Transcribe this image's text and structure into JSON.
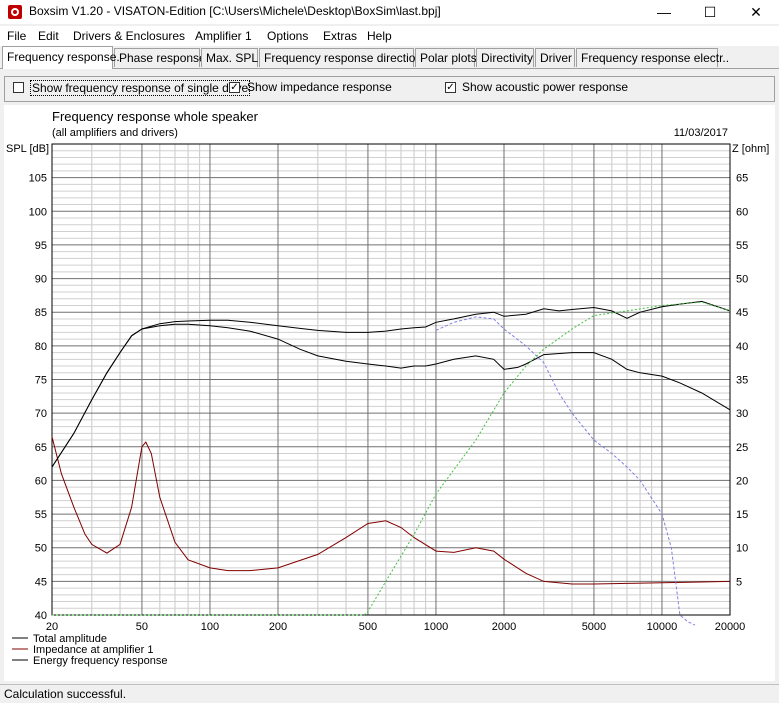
{
  "window": {
    "title": "Boxsim V1.20 - VISATON-Edition [C:\\Users\\Michele\\Desktop\\BoxSim\\last.bpj]",
    "minimize_glyph": "—",
    "maximize_glyph": "☐",
    "close_glyph": "✕"
  },
  "menu": [
    "File",
    "Edit",
    "Drivers & Enclosures",
    "Amplifier 1",
    "Options",
    "Extras",
    "Help"
  ],
  "tabs": [
    "Frequency response.",
    "Phase response",
    "Max. SPL",
    "Frequency response directions",
    "Polar plots",
    "Directivity",
    "Driver",
    "Frequency response electr.."
  ],
  "active_tab": 0,
  "options": {
    "single_driver": {
      "label": "Show frequency response of single drive",
      "checked": false
    },
    "impedance": {
      "label": "Show impedance response",
      "checked": true
    },
    "acoustic_power": {
      "label": "Show acoustic power response",
      "checked": true
    }
  },
  "status": "Calculation successful.",
  "chart_data": {
    "type": "line",
    "title": "Frequency response whole speaker",
    "subtitle": "(all amplifiers and drivers)",
    "date": "11/03/2017",
    "ylabel": "SPL [dB]",
    "y2label": "Z [ohm]",
    "xscale": "log",
    "xlim": [
      20,
      20000
    ],
    "ylim": [
      40,
      110
    ],
    "y2lim": [
      0,
      70
    ],
    "x_ticks": [
      20,
      50,
      100,
      200,
      500,
      1000,
      2000,
      5000,
      10000,
      20000
    ],
    "y_ticks": [
      40,
      45,
      50,
      55,
      60,
      65,
      70,
      75,
      80,
      85,
      90,
      95,
      100,
      105
    ],
    "y2_ticks": [
      5,
      10,
      15,
      20,
      25,
      30,
      35,
      40,
      45,
      50,
      55,
      60,
      65
    ],
    "grid": true,
    "legend_position": "bottom-left",
    "series": [
      {
        "name": "Total amplitude",
        "color": "#000000",
        "dash": "",
        "x": [
          20,
          25,
          30,
          35,
          40,
          45,
          50,
          60,
          70,
          80,
          100,
          120,
          150,
          200,
          250,
          300,
          400,
          500,
          600,
          700,
          800,
          900,
          1000,
          1200,
          1500,
          1800,
          2000,
          2500,
          3000,
          3500,
          4000,
          5000,
          6000,
          7000,
          8000,
          10000,
          12000,
          15000,
          20000
        ],
        "y": [
          62,
          67,
          72,
          76,
          79,
          81.5,
          82.5,
          83.3,
          83.6,
          83.7,
          83.8,
          83.8,
          83.5,
          83,
          82.6,
          82.3,
          82,
          82,
          82.2,
          82.5,
          82.7,
          82.8,
          83.5,
          84,
          84.7,
          85,
          84.4,
          84.7,
          85.5,
          85.2,
          85.4,
          85.7,
          85.2,
          84.1,
          85,
          85.8,
          86.2,
          86.6,
          85.2
        ]
      },
      {
        "name": "Impedance at amplifier 1",
        "color": "#800000",
        "dash": "",
        "x": [
          20,
          22,
          25,
          28,
          30,
          35,
          40,
          45,
          50,
          52,
          55,
          60,
          70,
          80,
          100,
          120,
          150,
          200,
          300,
          400,
          500,
          600,
          700,
          800,
          1000,
          1200,
          1500,
          1800,
          2000,
          2500,
          3000,
          4000,
          5000,
          7000,
          10000,
          15000,
          20000
        ],
        "y": [
          26.5,
          21,
          16,
          12,
          10.5,
          9.2,
          10.5,
          16,
          25,
          25.7,
          24,
          17.5,
          10.8,
          8.2,
          7,
          6.6,
          6.6,
          7,
          9,
          11.5,
          13.6,
          14,
          13,
          11.5,
          9.5,
          9.3,
          10,
          9.5,
          8.3,
          6.2,
          5,
          4.6,
          4.6,
          4.7,
          4.8,
          4.9,
          5
        ]
      },
      {
        "name": "Energy frequency response",
        "color": "#000000",
        "dash": "",
        "x": [
          20,
          25,
          30,
          35,
          40,
          45,
          50,
          60,
          70,
          80,
          100,
          120,
          150,
          200,
          250,
          300,
          400,
          500,
          600,
          700,
          800,
          900,
          1000,
          1200,
          1500,
          1800,
          2000,
          2300,
          2500,
          3000,
          4000,
          5000,
          6000,
          7000,
          8000,
          10000,
          12000,
          15000,
          20000
        ],
        "y": [
          62,
          67,
          72,
          76,
          79,
          81.5,
          82.5,
          83,
          83.2,
          83.2,
          83,
          82.7,
          82.2,
          81,
          79.5,
          78.5,
          77.7,
          77.3,
          77,
          76.7,
          77,
          77,
          77.3,
          78,
          78.5,
          78,
          76.5,
          76.8,
          77.3,
          78.7,
          79,
          79,
          78,
          76.5,
          76,
          75.5,
          74.5,
          73,
          70.5
        ]
      },
      {
        "name": "",
        "color": "#8080e0",
        "dash": "3,2",
        "x": [
          1000,
          1200,
          1500,
          1800,
          2000,
          2500,
          3000,
          3500,
          4000,
          5000,
          6000,
          7000,
          8000,
          10000,
          11000,
          12000,
          13000,
          14000
        ],
        "y": [
          82.3,
          83.5,
          84.3,
          84,
          82.5,
          80,
          77.5,
          73,
          70,
          66,
          64,
          62,
          60,
          55,
          50,
          40,
          39,
          38.5
        ]
      },
      {
        "name": "",
        "color": "#40c040",
        "dash": "2,2",
        "x": [
          20,
          100,
          300,
          480,
          500,
          600,
          800,
          1000,
          1500,
          2000,
          2500,
          3000,
          4000,
          5000,
          7000,
          10000,
          15000,
          20000
        ],
        "y": [
          40,
          40,
          40,
          40,
          40.5,
          45,
          52,
          58,
          66,
          73,
          77,
          79.5,
          82.5,
          84.5,
          85.2,
          86,
          86.5,
          85.2
        ]
      }
    ]
  }
}
